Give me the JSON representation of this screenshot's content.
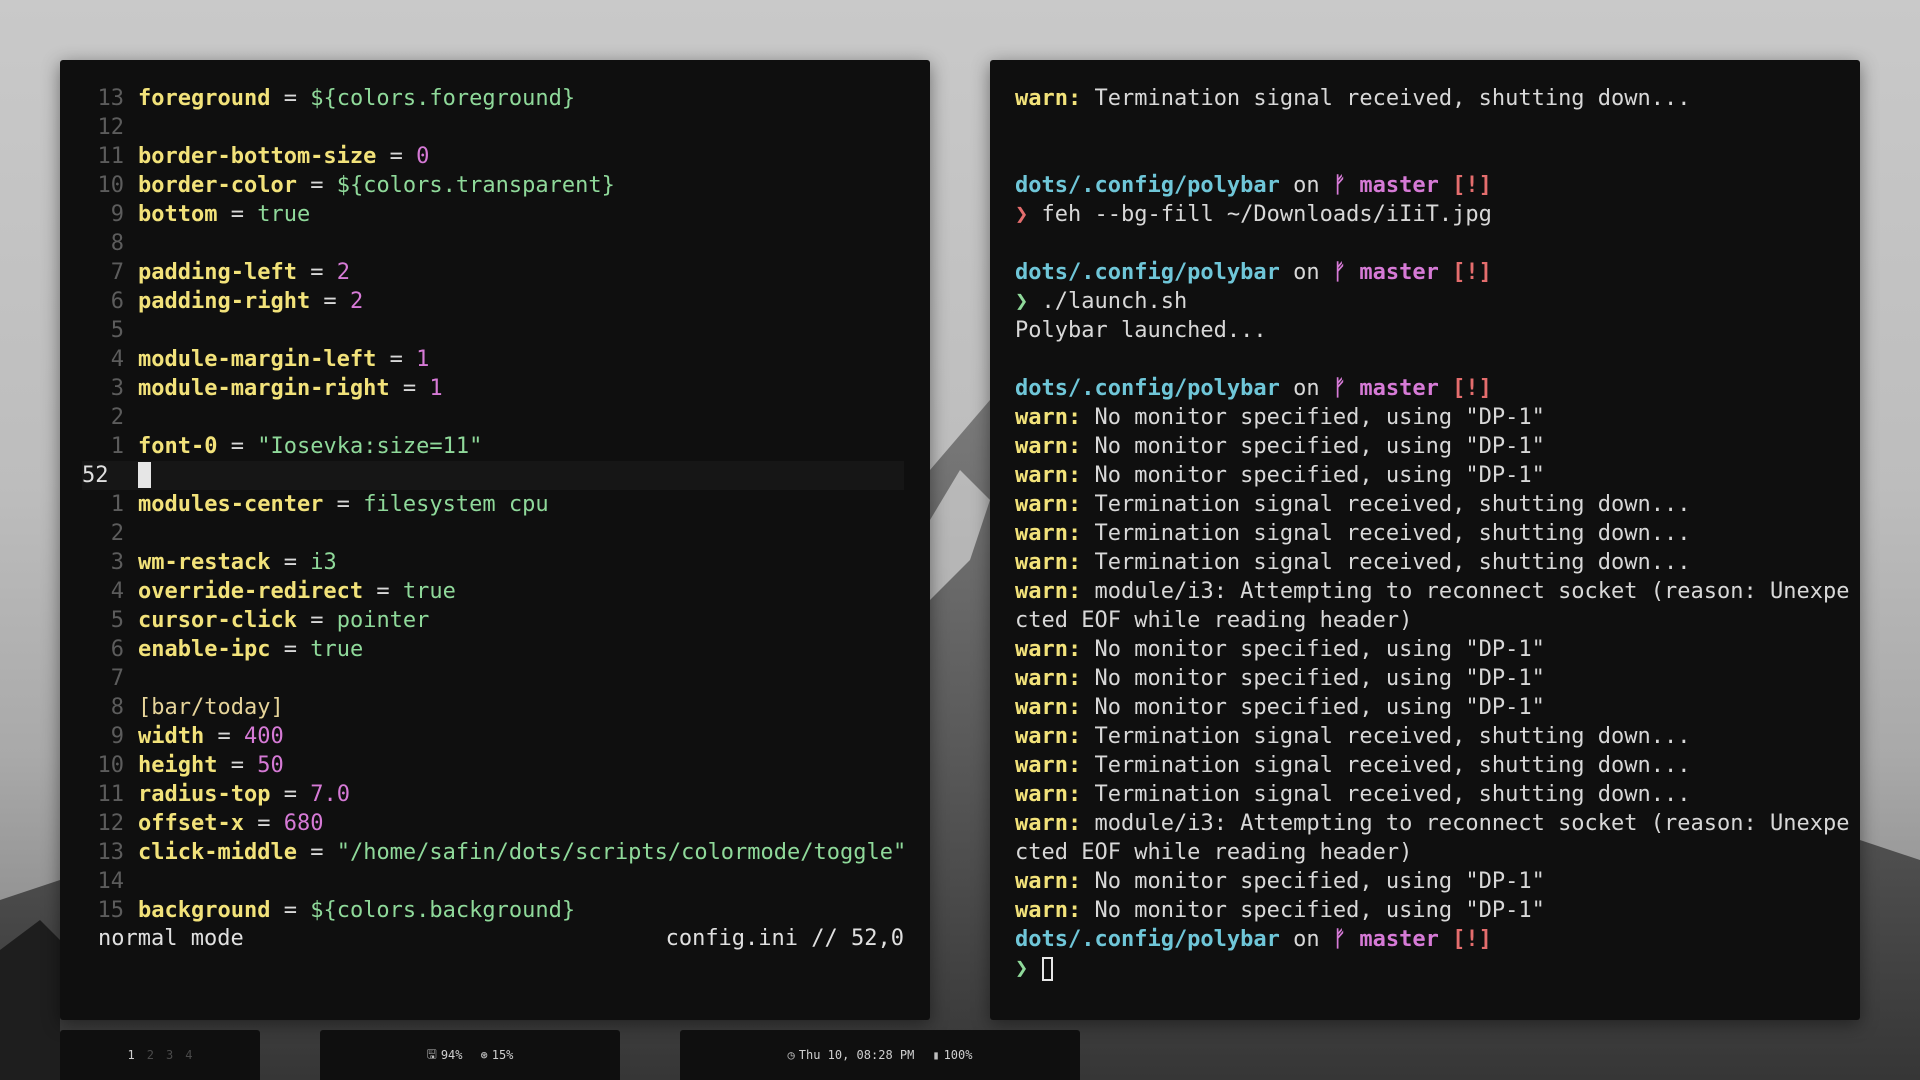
{
  "editor": {
    "lines": [
      {
        "n": "13",
        "key": "foreground",
        "val": "${colors.foreground}",
        "vt": "str"
      },
      {
        "n": "12"
      },
      {
        "n": "11",
        "key": "border-bottom-size",
        "val": "0",
        "vt": "num"
      },
      {
        "n": "10",
        "key": "border-color",
        "val": "${colors.transparent}",
        "vt": "str"
      },
      {
        "n": "9",
        "key": "bottom",
        "val": "true",
        "vt": "str"
      },
      {
        "n": "8"
      },
      {
        "n": "7",
        "key": "padding-left",
        "val": "2",
        "vt": "num"
      },
      {
        "n": "6",
        "key": "padding-right",
        "val": "2",
        "vt": "num"
      },
      {
        "n": "5"
      },
      {
        "n": "4",
        "key": "module-margin-left",
        "val": "1",
        "vt": "num"
      },
      {
        "n": "3",
        "key": "module-margin-right",
        "val": "1",
        "vt": "num"
      },
      {
        "n": "2"
      },
      {
        "n": "1",
        "key": "font-0",
        "val": "\"Iosevka:size=11\"",
        "vt": "str"
      },
      {
        "n": "52",
        "current": true
      },
      {
        "n": "1",
        "key": "modules-center",
        "val": "filesystem cpu",
        "vt": "str"
      },
      {
        "n": "2"
      },
      {
        "n": "3",
        "key": "wm-restack",
        "val": "i3",
        "vt": "str"
      },
      {
        "n": "4",
        "key": "override-redirect",
        "val": "true",
        "vt": "str"
      },
      {
        "n": "5",
        "key": "cursor-click",
        "val": "pointer",
        "vt": "str"
      },
      {
        "n": "6",
        "key": "enable-ipc",
        "val": "true",
        "vt": "str"
      },
      {
        "n": "7"
      },
      {
        "n": "8",
        "section": "[bar/today]"
      },
      {
        "n": "9",
        "key": "width",
        "val": "400",
        "vt": "num"
      },
      {
        "n": "10",
        "key": "height",
        "val": "50",
        "vt": "num"
      },
      {
        "n": "11",
        "key": "radius-top",
        "val": "7.0",
        "vt": "num"
      },
      {
        "n": "12",
        "key": "offset-x",
        "val": "680",
        "vt": "num"
      },
      {
        "n": "13",
        "key": "click-middle",
        "val": "\"/home/safin/dots/scripts/colormode/toggle\"",
        "vt": "str"
      },
      {
        "n": "14"
      },
      {
        "n": "15",
        "key": "background",
        "val": "${colors.background}",
        "vt": "str"
      }
    ],
    "status_mode": "normal mode",
    "status_file": "config.ini // 52,0"
  },
  "shell": {
    "lines": [
      {
        "t": "warn",
        "text": "Termination signal received, shutting down..."
      },
      {
        "t": "blank"
      },
      {
        "t": "blank"
      },
      {
        "t": "prompt"
      },
      {
        "t": "cmd",
        "sym": "❯",
        "sym_color": "red",
        "text": "feh --bg-fill ~/Downloads/iIiT.jpg"
      },
      {
        "t": "blank"
      },
      {
        "t": "prompt"
      },
      {
        "t": "cmd",
        "sym": "❯",
        "sym_color": "green",
        "text": "./launch.sh"
      },
      {
        "t": "plain",
        "text": "Polybar launched..."
      },
      {
        "t": "blank"
      },
      {
        "t": "prompt"
      },
      {
        "t": "warn",
        "text": "No monitor specified, using \"DP-1\""
      },
      {
        "t": "warn",
        "text": "No monitor specified, using \"DP-1\""
      },
      {
        "t": "warn",
        "text": "No monitor specified, using \"DP-1\""
      },
      {
        "t": "warn",
        "text": "Termination signal received, shutting down..."
      },
      {
        "t": "warn",
        "text": "Termination signal received, shutting down..."
      },
      {
        "t": "warn",
        "text": "Termination signal received, shutting down..."
      },
      {
        "t": "warn",
        "text": "module/i3: Attempting to reconnect socket (reason: Unexpe"
      },
      {
        "t": "plain",
        "text": "cted EOF while reading header)"
      },
      {
        "t": "warn",
        "text": "No monitor specified, using \"DP-1\""
      },
      {
        "t": "warn",
        "text": "No monitor specified, using \"DP-1\""
      },
      {
        "t": "warn",
        "text": "No monitor specified, using \"DP-1\""
      },
      {
        "t": "warn",
        "text": "Termination signal received, shutting down..."
      },
      {
        "t": "warn",
        "text": "Termination signal received, shutting down..."
      },
      {
        "t": "warn",
        "text": "Termination signal received, shutting down..."
      },
      {
        "t": "warn",
        "text": "module/i3: Attempting to reconnect socket (reason: Unexpe"
      },
      {
        "t": "plain",
        "text": "cted EOF while reading header)"
      },
      {
        "t": "warn",
        "text": "No monitor specified, using \"DP-1\""
      },
      {
        "t": "warn",
        "text": "No monitor specified, using \"DP-1\""
      },
      {
        "t": "prompt"
      },
      {
        "t": "input",
        "sym": "❯",
        "sym_color": "green"
      }
    ],
    "warn_label": "warn:",
    "prompt_path": "dots/.config/polybar",
    "prompt_on": " on ",
    "prompt_branch_icon": "ᚠ",
    "prompt_branch": "master",
    "prompt_flag": "[!]"
  },
  "bars": {
    "workspaces": [
      "1",
      "2",
      "3",
      "4"
    ],
    "active_workspace": "1",
    "disk_icon": "🖫",
    "disk": "94%",
    "cpu_icon": "⊛",
    "cpu": "15%",
    "clock_icon": "◷",
    "clock": "Thu 10, 08:28 PM",
    "battery_icon": "▮",
    "battery": "100%"
  },
  "colors": {
    "terminal_bg": "#0f0f0f",
    "key": "#f2e27a",
    "string": "#8fd99a",
    "number": "#d67ad6",
    "path": "#6fc6d8",
    "flag": "#e46d6d"
  }
}
